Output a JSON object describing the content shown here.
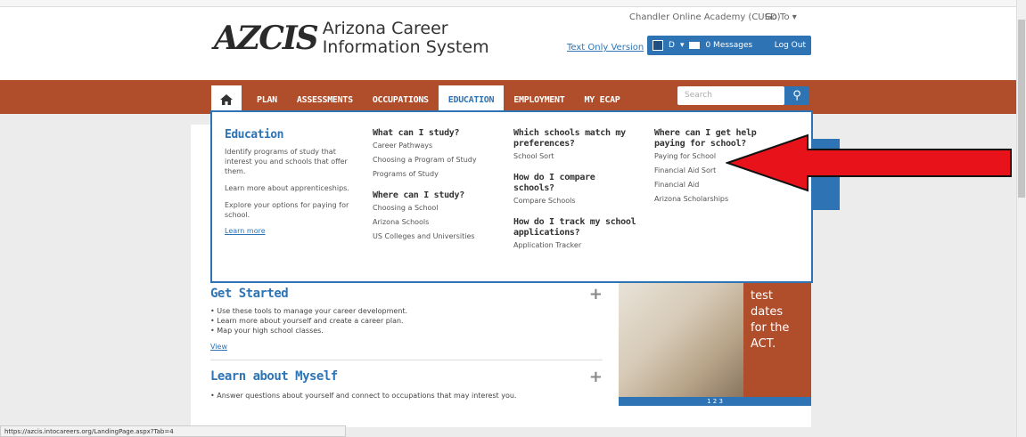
{
  "header": {
    "logo_mark": "AZCIS",
    "logo_line1": "Arizona Career",
    "logo_line2": "Information System",
    "school": "Chandler Online Academy (CUSD)",
    "goto": "Go To",
    "text_only": "Text Only Version",
    "user_initial": "D",
    "messages": "0 Messages",
    "logout": "Log Out"
  },
  "nav": {
    "items": [
      "PLAN",
      "ASSESSMENTS",
      "OCCUPATIONS",
      "EDUCATION",
      "EMPLOYMENT",
      "MY ECAP"
    ],
    "search_placeholder": "Search"
  },
  "dropdown": {
    "title": "Education",
    "desc1": "Identify programs of study that interest you and schools that offer them.",
    "desc2": "Learn more about apprenticeships.",
    "desc3": "Explore your options for paying for school.",
    "learn_more": "Learn more",
    "col2": {
      "h1": "What can I study?",
      "links1": [
        "Career Pathways",
        "Choosing a Program of Study",
        "Programs of Study"
      ],
      "h2": "Where can I study?",
      "links2": [
        "Choosing a School",
        "Arizona Schools",
        "US Colleges and Universities"
      ]
    },
    "col3": {
      "h1": "Which schools match my preferences?",
      "links1": [
        "School Sort"
      ],
      "h2": "How do I compare schools?",
      "links2": [
        "Compare Schools"
      ],
      "h3": "How do I track my school applications?",
      "links3": [
        "Application Tracker"
      ]
    },
    "col4": {
      "h1": "Where can I get help paying for school?",
      "links1": [
        "Paying for School",
        "Financial Aid Sort",
        "Financial Aid",
        "Arizona Scholarships"
      ]
    }
  },
  "content": {
    "get_started": "Get Started",
    "gs_bullets": [
      "Use these tools to manage your career development.",
      "Learn more about yourself and create a career plan.",
      "Map your high school classes."
    ],
    "view": "View",
    "learn_myself": "Learn about Myself",
    "lm_bullets": [
      "Answer questions about yourself and connect to occupations that may interest you."
    ],
    "plus": "+"
  },
  "promo": {
    "lines": [
      "test",
      "dates",
      "for the",
      "ACT."
    ],
    "dots": "1 2 3"
  },
  "status_url": "https://azcis.intocareers.org/LandingPage.aspx?Tab=4",
  "colors": {
    "brand_blue": "#2e74b5",
    "nav_rust": "#b04d2a",
    "arrow_red": "#e8121a"
  }
}
